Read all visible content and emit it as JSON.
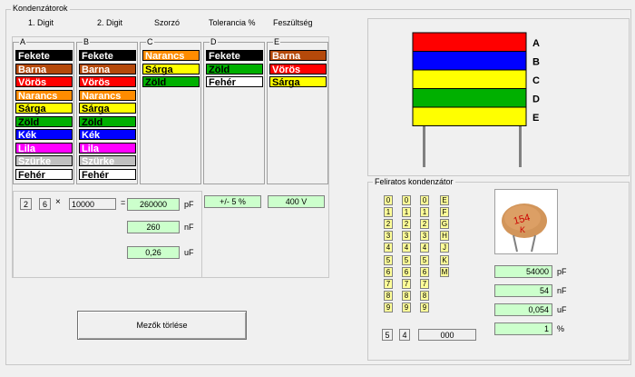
{
  "group_title": "Kondenzátorok",
  "headers": {
    "digit1": "1. Digit",
    "digit2": "2. Digit",
    "multiplier": "Szorzó",
    "tolerance": "Tolerancia %",
    "voltage": "Feszültség"
  },
  "lists": {
    "A": {
      "label": "A",
      "items": [
        {
          "name": "Fekete",
          "bg": "#000000",
          "fg": "#ffffff"
        },
        {
          "name": "Barna",
          "bg": "#b5490a",
          "fg": "#ffffff"
        },
        {
          "name": "Vörös",
          "bg": "#ff0000",
          "fg": "#ffffff"
        },
        {
          "name": "Narancs",
          "bg": "#ff8c00",
          "fg": "#ffffff"
        },
        {
          "name": "Sárga",
          "bg": "#ffff00",
          "fg": "#000000"
        },
        {
          "name": "Zöld",
          "bg": "#00b000",
          "fg": "#000000"
        },
        {
          "name": "Kék",
          "bg": "#0000ff",
          "fg": "#ffffff"
        },
        {
          "name": "Lila",
          "bg": "#ff00ff",
          "fg": "#ffffff"
        },
        {
          "name": "Szürke",
          "bg": "#c0c0c0",
          "fg": "#ffffff"
        },
        {
          "name": "Fehér",
          "bg": "#ffffff",
          "fg": "#000000"
        }
      ]
    },
    "B": {
      "label": "B",
      "items": [
        {
          "name": "Fekete",
          "bg": "#000000",
          "fg": "#ffffff"
        },
        {
          "name": "Barna",
          "bg": "#b5490a",
          "fg": "#ffffff"
        },
        {
          "name": "Vörös",
          "bg": "#ff0000",
          "fg": "#ffffff"
        },
        {
          "name": "Narancs",
          "bg": "#ff8c00",
          "fg": "#ffffff"
        },
        {
          "name": "Sárga",
          "bg": "#ffff00",
          "fg": "#000000"
        },
        {
          "name": "Zöld",
          "bg": "#00b000",
          "fg": "#000000"
        },
        {
          "name": "Kék",
          "bg": "#0000ff",
          "fg": "#ffffff"
        },
        {
          "name": "Lila",
          "bg": "#ff00ff",
          "fg": "#ffffff"
        },
        {
          "name": "Szürke",
          "bg": "#c0c0c0",
          "fg": "#ffffff"
        },
        {
          "name": "Fehér",
          "bg": "#ffffff",
          "fg": "#000000"
        }
      ]
    },
    "C": {
      "label": "C",
      "items": [
        {
          "name": "Narancs",
          "bg": "#ff8c00",
          "fg": "#ffffff"
        },
        {
          "name": "Sárga",
          "bg": "#ffff00",
          "fg": "#000000"
        },
        {
          "name": "Zöld",
          "bg": "#00b000",
          "fg": "#000000"
        }
      ]
    },
    "D": {
      "label": "D",
      "items": [
        {
          "name": "Fekete",
          "bg": "#000000",
          "fg": "#ffffff"
        },
        {
          "name": "Zöld",
          "bg": "#00b000",
          "fg": "#000000"
        },
        {
          "name": "Fehér",
          "bg": "#ffffff",
          "fg": "#000000"
        }
      ]
    },
    "E": {
      "label": "E",
      "items": [
        {
          "name": "Barna",
          "bg": "#b5490a",
          "fg": "#ffffff"
        },
        {
          "name": "Vörös",
          "bg": "#ff0000",
          "fg": "#ffffff"
        },
        {
          "name": "Sárga",
          "bg": "#ffff00",
          "fg": "#000000"
        }
      ]
    }
  },
  "calc": {
    "digit1": "2",
    "digit2": "6",
    "times": "×",
    "multiplier": "10000",
    "equals": "=",
    "pf": "260000",
    "nf": "260",
    "uf": "0,26",
    "tolerance": "+/- 5 %",
    "voltage": "400 V",
    "unit_pf": "pF",
    "unit_nf": "nF",
    "unit_uf": "uF"
  },
  "clear_button": "Mezők törlése",
  "capacitor": {
    "bands": [
      {
        "letter": "A",
        "color": "#ff0000"
      },
      {
        "letter": "B",
        "color": "#0000ff"
      },
      {
        "letter": "C",
        "color": "#ffff00"
      },
      {
        "letter": "D",
        "color": "#00b000"
      },
      {
        "letter": "E",
        "color": "#ffff00"
      }
    ]
  },
  "labeled": {
    "title": "Feliratos kondenzátor",
    "col1": [
      "0",
      "1",
      "2",
      "3",
      "4",
      "5",
      "6",
      "7",
      "8",
      "9"
    ],
    "col2": [
      "0",
      "1",
      "2",
      "3",
      "4",
      "5",
      "6",
      "7",
      "8",
      "9"
    ],
    "col3": [
      "0",
      "1",
      "2",
      "3",
      "4",
      "5",
      "6",
      "7",
      "8",
      "9"
    ],
    "col4": [
      "E",
      "F",
      "G",
      "H",
      "J",
      "K",
      "M"
    ],
    "sel1": "5",
    "sel2": "4",
    "sel3": "000",
    "cap_text1": "154",
    "cap_text2": "K",
    "pf": "54000",
    "nf": "54",
    "uf": "0,054",
    "pct": "1",
    "unit_pf": "pF",
    "unit_nf": "nF",
    "unit_uf": "uF",
    "unit_pct": "%"
  }
}
